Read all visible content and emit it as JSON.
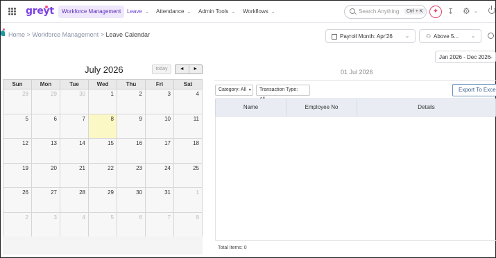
{
  "nav": {
    "logo": "greyt",
    "items": [
      {
        "label": "Workforce Management",
        "has_chevron": false
      },
      {
        "label": "Leave",
        "has_chevron": true
      },
      {
        "label": "Attendance",
        "has_chevron": true
      },
      {
        "label": "Admin Tools",
        "has_chevron": true
      },
      {
        "label": "Workflows",
        "has_chevron": true
      }
    ],
    "search_placeholder": "Search Anything",
    "search_shortcut": "Ctrl + K",
    "icons": [
      "apps-grid-icon",
      "sparkle-icon",
      "download-icon",
      "gear-icon",
      "power-icon"
    ]
  },
  "breadcrumb": {
    "home": "Home",
    "sep": ">",
    "section": "Workforce Management",
    "current": "Leave Calendar"
  },
  "filters": {
    "payroll_label": "Payroll Month:",
    "payroll_value": "Apr'26",
    "employee_filter": "Above 5...",
    "date_range": "Jan 2026 - Dec 2026"
  },
  "calendar": {
    "title": "July 2026",
    "today_label": "today",
    "prev": "◄",
    "next": "►",
    "weekdays": [
      "Sun",
      "Mon",
      "Tue",
      "Wed",
      "Thu",
      "Fri",
      "Sat"
    ],
    "weeks": [
      [
        {
          "d": "28",
          "o": true
        },
        {
          "d": "29",
          "o": true
        },
        {
          "d": "30",
          "o": true
        },
        {
          "d": "1"
        },
        {
          "d": "2"
        },
        {
          "d": "3"
        },
        {
          "d": "4"
        }
      ],
      [
        {
          "d": "5"
        },
        {
          "d": "6"
        },
        {
          "d": "7"
        },
        {
          "d": "8",
          "today": true
        },
        {
          "d": "9"
        },
        {
          "d": "10"
        },
        {
          "d": "11"
        }
      ],
      [
        {
          "d": "12"
        },
        {
          "d": "13"
        },
        {
          "d": "14"
        },
        {
          "d": "15"
        },
        {
          "d": "16"
        },
        {
          "d": "17"
        },
        {
          "d": "18"
        }
      ],
      [
        {
          "d": "19"
        },
        {
          "d": "20"
        },
        {
          "d": "21"
        },
        {
          "d": "22"
        },
        {
          "d": "23"
        },
        {
          "d": "24"
        },
        {
          "d": "25"
        }
      ],
      [
        {
          "d": "26"
        },
        {
          "d": "27"
        },
        {
          "d": "28"
        },
        {
          "d": "29"
        },
        {
          "d": "30"
        },
        {
          "d": "31"
        },
        {
          "d": "1",
          "o": true
        }
      ],
      [
        {
          "d": "2",
          "o": true
        },
        {
          "d": "3",
          "o": true
        },
        {
          "d": "4",
          "o": true
        },
        {
          "d": "5",
          "o": true
        },
        {
          "d": "6",
          "o": true
        },
        {
          "d": "7",
          "o": true
        },
        {
          "d": "8",
          "o": true
        }
      ]
    ]
  },
  "details": {
    "selected_date": "01 Jul 2026",
    "category_filter": "Category: All",
    "transaction_filter": "Transaction Type: All",
    "export_label": "Export To Excel",
    "columns": [
      "Name",
      "Employee No",
      "Details"
    ],
    "rows": [],
    "total_label": "Total Items: 0"
  },
  "colors": {
    "brand": "#7b3fe4",
    "today_highlight": "#fcf8c6",
    "table_header": "#e9edf3"
  }
}
